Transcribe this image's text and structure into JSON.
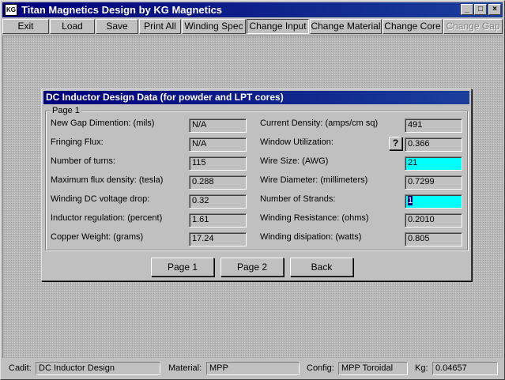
{
  "window": {
    "icon_text": "KG",
    "title": "Titan Magnetics Design by KG Magnetics",
    "minimize": "_",
    "maximize": "□",
    "close": "×"
  },
  "menu": [
    {
      "label": "Exit",
      "state": "normal"
    },
    {
      "label": "Load",
      "state": "normal"
    },
    {
      "label": "Save",
      "state": "normal"
    },
    {
      "label": "Print All",
      "state": "normal"
    },
    {
      "label": "Winding Spec",
      "state": "normal"
    },
    {
      "label": "Change Input",
      "state": "pressed"
    },
    {
      "label": "Change Material",
      "state": "normal"
    },
    {
      "label": "Change Core",
      "state": "normal"
    },
    {
      "label": "Change Gap",
      "state": "disabled"
    }
  ],
  "dialog": {
    "title": "DC Inductor Design Data (for powder and LPT cores)",
    "group_label": "Page 1",
    "left_fields": [
      {
        "label": "New Gap Dimention: (mils)",
        "value": "N/A"
      },
      {
        "label": "Fringing Flux:",
        "value": "N/A"
      },
      {
        "label": "Number of turns:",
        "value": "115"
      },
      {
        "label": "Maximum flux density: (tesla)",
        "value": "0.288"
      },
      {
        "label": "Winding DC voltage drop:",
        "value": "0.32"
      },
      {
        "label": "Inductor regulation: (percent)",
        "value": "1.61"
      },
      {
        "label": "Copper Weight: (grams)",
        "value": "17.24"
      }
    ],
    "right_fields": [
      {
        "label": "Current Density: (amps/cm sq)",
        "value": "491"
      },
      {
        "label": "Window Utilization:",
        "value": "0.366"
      },
      {
        "label": "Wire Size: (AWG)",
        "value": "21"
      },
      {
        "label": "Wire Diameter: (millimeters)",
        "value": "0.7299"
      },
      {
        "label": "Number of Strands:",
        "value": "1"
      },
      {
        "label": "Winding Resistance: (ohms)",
        "value": "0.2010"
      },
      {
        "label": "Winding disipation: (watts)",
        "value": "0.805"
      }
    ],
    "help_label": "?",
    "buttons": {
      "page1": "Page 1",
      "page2": "Page 2",
      "back": "Back"
    }
  },
  "status": {
    "cadit_label": "Cadit:",
    "cadit_value": "DC Inductor Design",
    "material_label": "Material:",
    "material_value": "MPP",
    "config_label": "Config:",
    "config_value": "MPP Toroidal",
    "kg_label": "Kg:",
    "kg_value": "0.04657"
  },
  "colors": {
    "title_bar": "#00007b",
    "editable_field": "#00ffff",
    "selection": "#000080"
  }
}
